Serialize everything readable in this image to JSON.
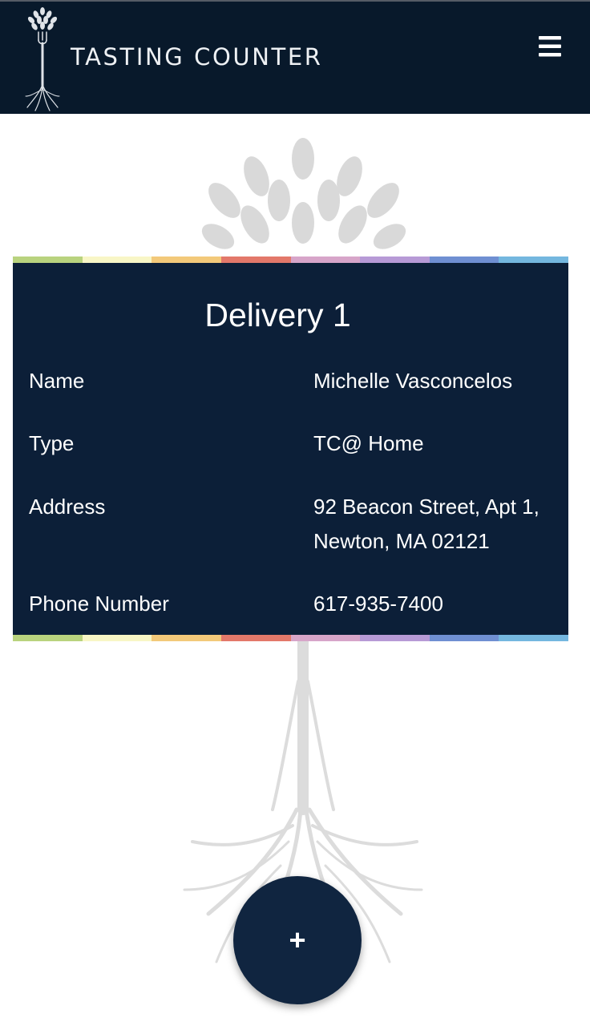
{
  "header": {
    "brand": "TASTING COUNTER",
    "logo_icon": "tree-fork-logo-icon",
    "menu_icon": "hamburger-menu-icon"
  },
  "card": {
    "title": "Delivery 1",
    "rows": [
      {
        "label": "Name",
        "value": "Michelle Vasconcelos"
      },
      {
        "label": "Type",
        "value": "TC@ Home"
      },
      {
        "label": "Address",
        "value": "92 Beacon Street, Apt 1, Newton, MA 02121"
      },
      {
        "label": "Phone Number",
        "value": "617-935-7400"
      }
    ],
    "stripe_colors": [
      "#b9d37e",
      "#f8f6c6",
      "#f3c97a",
      "#e3786a",
      "#d7a5c9",
      "#b79ad6",
      "#6f8fd2",
      "#74b7df"
    ]
  },
  "fab": {
    "label": "+"
  },
  "colors": {
    "header_bg": "#08192b",
    "card_bg": "#0c1f38",
    "fab_bg": "#102540"
  }
}
